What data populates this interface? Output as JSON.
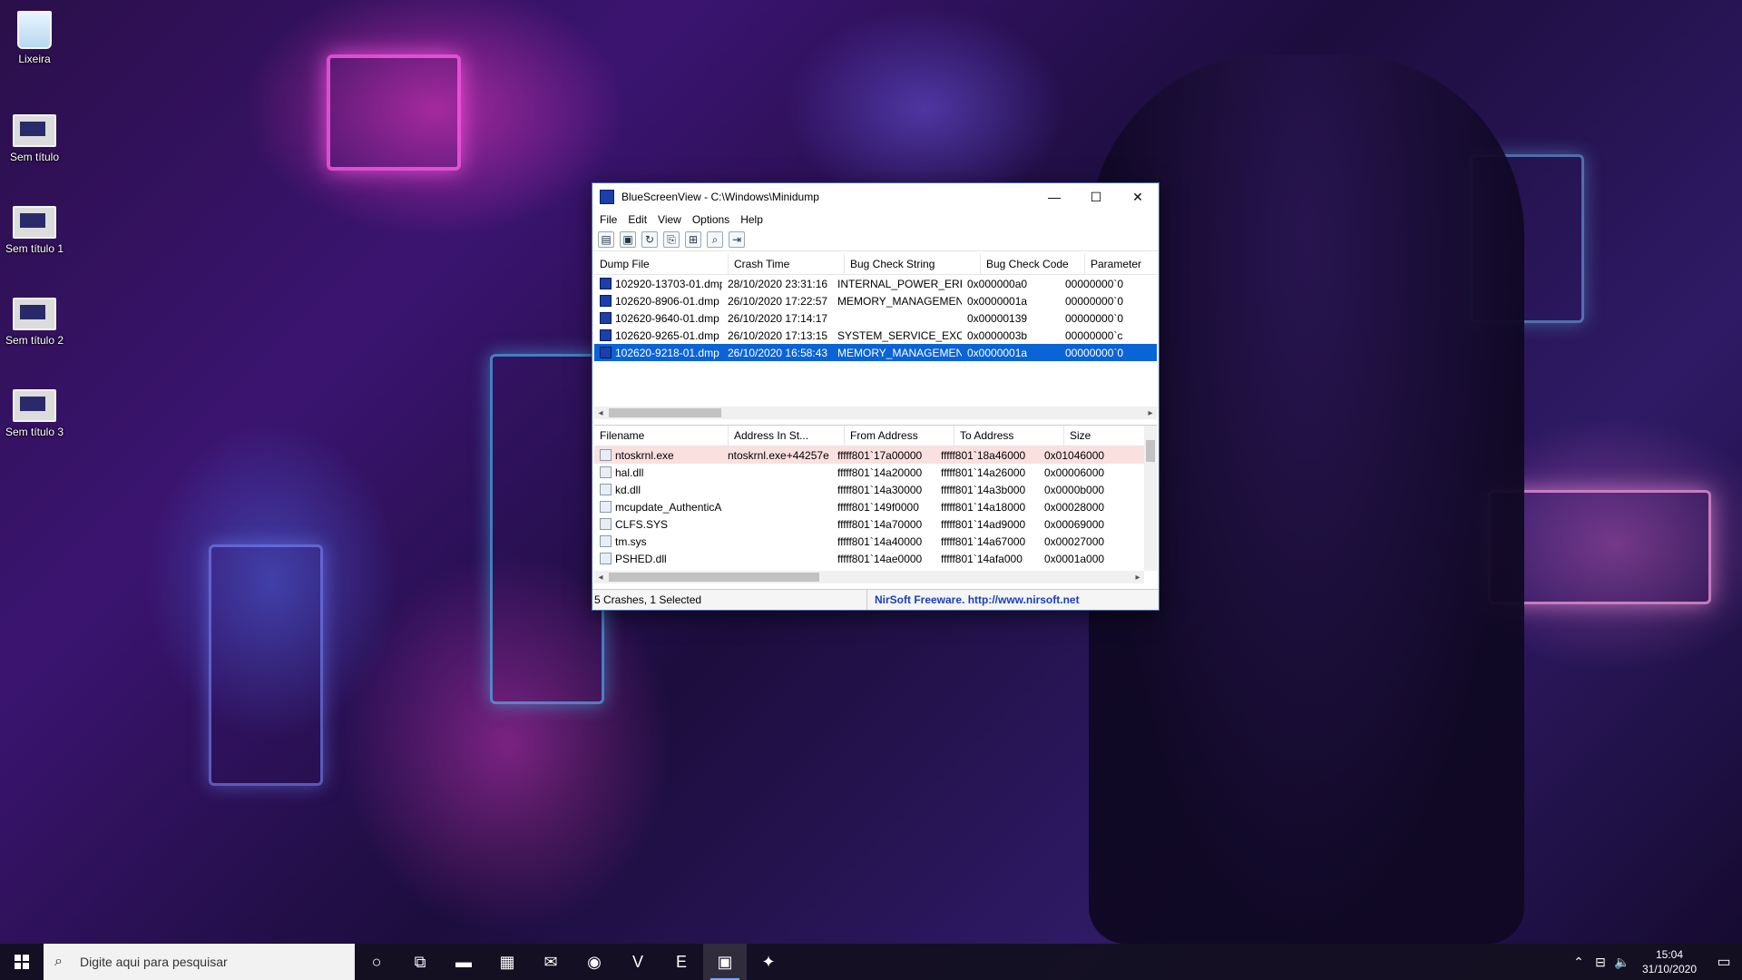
{
  "desktop": {
    "icons": [
      {
        "label": "Lixeira"
      },
      {
        "label": "Sem título"
      },
      {
        "label": "Sem título 1"
      },
      {
        "label": "Sem título 2"
      },
      {
        "label": "Sem título 3"
      }
    ]
  },
  "window": {
    "title": "BlueScreenView - C:\\Windows\\Minidump",
    "controls": {
      "minimize": "—",
      "maximize": "☐",
      "close": "✕"
    },
    "menu": [
      "File",
      "Edit",
      "View",
      "Options",
      "Help"
    ],
    "toolbar": [
      {
        "icon": "properties-icon",
        "glyph": "▤"
      },
      {
        "icon": "save-icon",
        "glyph": "▣"
      },
      {
        "icon": "refresh-icon",
        "glyph": "↻"
      },
      {
        "icon": "copy-icon",
        "glyph": "⎘"
      },
      {
        "icon": "html-report-icon",
        "glyph": "⊞"
      },
      {
        "icon": "find-icon",
        "glyph": "⌕"
      },
      {
        "icon": "exit-icon",
        "glyph": "⇥"
      }
    ],
    "crash_table": {
      "columns": [
        "Dump File",
        "Crash Time",
        "Bug Check String",
        "Bug Check Code",
        "Parameter"
      ],
      "rows": [
        [
          "102920-13703-01.dmp",
          "28/10/2020 23:31:16",
          "INTERNAL_POWER_ERR...",
          "0x000000a0",
          "00000000`0"
        ],
        [
          "102620-8906-01.dmp",
          "26/10/2020 17:22:57",
          "MEMORY_MANAGEMENT",
          "0x0000001a",
          "00000000`0"
        ],
        [
          "102620-9640-01.dmp",
          "26/10/2020 17:14:17",
          "",
          "0x00000139",
          "00000000`0"
        ],
        [
          "102620-9265-01.dmp",
          "26/10/2020 17:13:15",
          "SYSTEM_SERVICE_EXCEP...",
          "0x0000003b",
          "00000000`c"
        ],
        [
          "102620-9218-01.dmp",
          "26/10/2020 16:58:43",
          "MEMORY_MANAGEMENT",
          "0x0000001a",
          "00000000`0"
        ]
      ],
      "selected_index": 4
    },
    "driver_table": {
      "columns": [
        "Filename",
        "Address In St...",
        "From Address",
        "To Address",
        "Size"
      ],
      "rows": [
        [
          "ntoskrnl.exe",
          "ntoskrnl.exe+44257e",
          "fffff801`17a00000",
          "fffff801`18a46000",
          "0x01046000"
        ],
        [
          "hal.dll",
          "",
          "fffff801`14a20000",
          "fffff801`14a26000",
          "0x00006000"
        ],
        [
          "kd.dll",
          "",
          "fffff801`14a30000",
          "fffff801`14a3b000",
          "0x0000b000"
        ],
        [
          "mcupdate_AuthenticAMD.dll",
          "",
          "fffff801`149f0000",
          "fffff801`14a18000",
          "0x00028000"
        ],
        [
          "CLFS.SYS",
          "",
          "fffff801`14a70000",
          "fffff801`14ad9000",
          "0x00069000"
        ],
        [
          "tm.sys",
          "",
          "fffff801`14a40000",
          "fffff801`14a67000",
          "0x00027000"
        ],
        [
          "PSHED.dll",
          "",
          "fffff801`14ae0000",
          "fffff801`14afa000",
          "0x0001a000"
        ]
      ],
      "highlight_index": 0
    },
    "status": {
      "left": "5 Crashes, 1 Selected",
      "right": "NirSoft Freeware.  http://www.nirsoft.net"
    }
  },
  "taskbar": {
    "search_placeholder": "Digite aqui para pesquisar",
    "apps": [
      {
        "icon": "cortana-icon",
        "glyph": "○"
      },
      {
        "icon": "task-view-icon",
        "glyph": "⧉"
      },
      {
        "icon": "file-explorer-icon",
        "glyph": "▬"
      },
      {
        "icon": "microsoft-store-icon",
        "glyph": "▦"
      },
      {
        "icon": "mail-icon",
        "glyph": "✉"
      },
      {
        "icon": "chrome-icon",
        "glyph": "◉"
      },
      {
        "icon": "vegas-icon",
        "glyph": "V"
      },
      {
        "icon": "epic-games-icon",
        "glyph": "E"
      },
      {
        "icon": "bluescreenview-icon",
        "glyph": "▣"
      },
      {
        "icon": "app-icon",
        "glyph": "✦"
      }
    ],
    "active_app_index": 8,
    "tray": {
      "chevron": "⌃",
      "network": "⊟",
      "volume": "🔈"
    },
    "time": "15:04",
    "date": "31/10/2020"
  }
}
